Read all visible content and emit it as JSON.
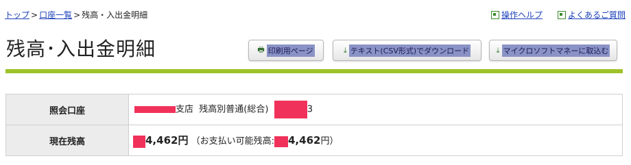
{
  "breadcrumb": {
    "top": "トップ",
    "sep1": ">",
    "accounts": "口座一覧",
    "sep2": ">",
    "current": "残高・入出金明細"
  },
  "help_links": {
    "operation_help": "操作ヘルプ",
    "faq": "よくあるご質問"
  },
  "page_title": "残高･入出金明細",
  "buttons": {
    "print": "印刷用ページ",
    "csv": "テキスト(CSV形式)でダウンロード",
    "ms_money": "マイクロソフトマネーに取込む"
  },
  "account_table": {
    "rows": [
      {
        "label": "照会口座",
        "branch_suffix": "支店",
        "account_type": "残高別普通(総合)",
        "number_tail": "3"
      },
      {
        "label": "現在残高",
        "balance_visible": "4,462",
        "yen": "円",
        "available_prefix": "（お支払い可能残高:",
        "available_visible": "4,462",
        "available_suffix": "円）"
      }
    ]
  },
  "colors": {
    "link": "#1a3fb8",
    "accent_green": "#9dc22a",
    "redaction": "#f0325a",
    "button_highlight": "#8a93c5"
  }
}
